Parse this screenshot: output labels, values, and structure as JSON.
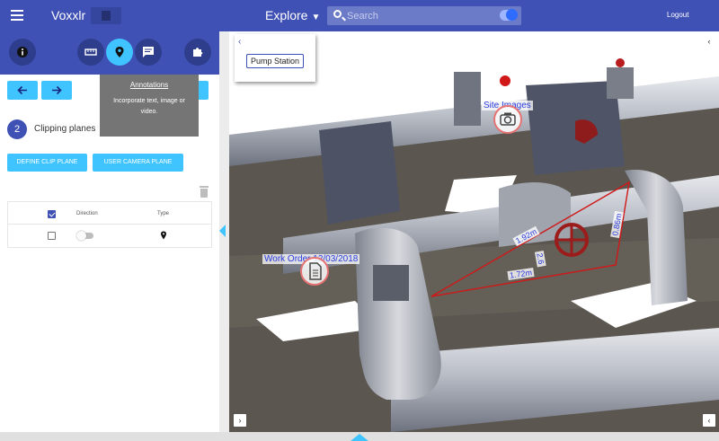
{
  "topbar": {
    "app_title": "Voxxlr",
    "explore_label": "Explore",
    "search_placeholder": "Search",
    "logout_label": "Logout"
  },
  "toolbar": {
    "tools": [
      "info-icon",
      "ruler-icon",
      "pin-icon",
      "comment-icon",
      "puzzle-icon"
    ],
    "active_tool": "pin-icon"
  },
  "panel": {
    "step_number": "2",
    "step_label": "Clipping planes",
    "tooltip_title": "Annotations",
    "tooltip_body": "Incorporate text, image or video.",
    "define_clip_plane_label": "DEFINE CLIP PLANE",
    "user_camera_plane_label": "USER CAMERA PLANE",
    "table": {
      "headers": [
        "",
        "Direction",
        "Type"
      ],
      "rows": [
        {
          "checked": false,
          "direction_on": false,
          "type_icon": "pin-icon"
        }
      ]
    }
  },
  "viewer": {
    "popup_button": "Pump Station",
    "tags": {
      "site_images": "Site Images",
      "work_order": "Work Order 12/03/2018"
    },
    "measurements": [
      "1.92m",
      "0.86m",
      "2.6",
      "1.72m"
    ]
  },
  "colors": {
    "primary": "#3f51b5",
    "accent": "#40c4ff",
    "measure_line": "#d01818",
    "tag_text": "#2a3bdc"
  }
}
